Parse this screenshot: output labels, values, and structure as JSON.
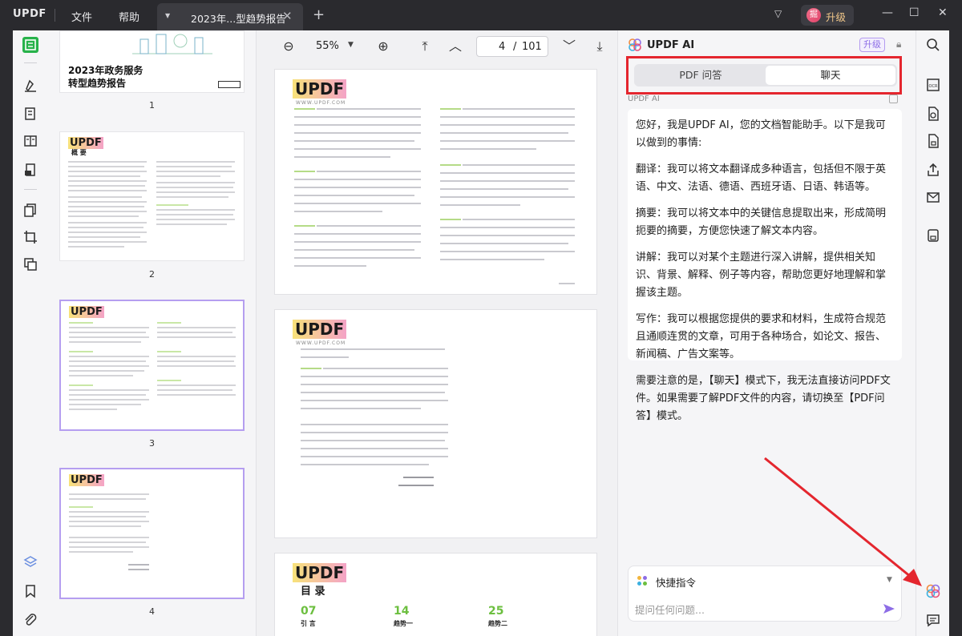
{
  "app": {
    "logo": "UPDF",
    "menu": [
      "文件",
      "帮助"
    ],
    "tab_title": "2023年...型趋势报告",
    "new_tab": "+",
    "upgrade_badge": "掘",
    "upgrade_label": "升级"
  },
  "thumbnails": {
    "cover_title_line1": "2023年政务服务",
    "cover_title_line2": "转型趋势报告",
    "page_numbers": [
      "1",
      "2",
      "3",
      "4"
    ],
    "thumb2_heading": "概 要",
    "mini_logo": "UPDF",
    "selected_page": 3
  },
  "toolbar": {
    "zoom_out": "−",
    "zoom": "55%",
    "zoom_in": "+",
    "current_page": "4",
    "slash": "/",
    "total_pages": "101"
  },
  "document": {
    "logo": "UPDF",
    "logo_sub": "WWW.UPDF.COM",
    "toc_title": "目 录",
    "toc_items": [
      {
        "num": "07",
        "label": "引 言"
      },
      {
        "num": "14",
        "label": "趋势一"
      },
      {
        "num": "25",
        "label": "趋势二"
      }
    ]
  },
  "ai": {
    "title": "UPDF AI",
    "upgrade": "升级",
    "tabs": [
      "PDF 问答",
      "聊天"
    ],
    "active_tab": "聊天",
    "source_label": "UPDF AI",
    "messages": [
      "您好，我是UPDF AI，您的文档智能助手。以下是我可以做到的事情:",
      "翻译：我可以将文本翻译成多种语言，包括但不限于英语、中文、法语、德语、西班牙语、日语、韩语等。",
      "摘要：我可以将文本中的关键信息提取出来，形成简明扼要的摘要，方便您快速了解文本内容。",
      "讲解：我可以对某个主题进行深入讲解，提供相关知识、背景、解释、例子等内容，帮助您更好地理解和掌握该主题。",
      "写作：我可以根据您提供的要求和材料，生成符合规范且通顺连贯的文章，可用于各种场合，如论文、报告、新闻稿、广告文案等。",
      "需要注意的是，【聊天】模式下，我无法直接访问PDF文件。如果需要了解PDF文件的内容，请切换至【PDF问答】模式。"
    ],
    "quick_command": "快捷指令",
    "input_placeholder": "提问任何问题..."
  },
  "colors": {
    "accent_purple": "#8d6de6",
    "highlight_red": "#e4262e",
    "doc_green": "#6cbf3f"
  }
}
